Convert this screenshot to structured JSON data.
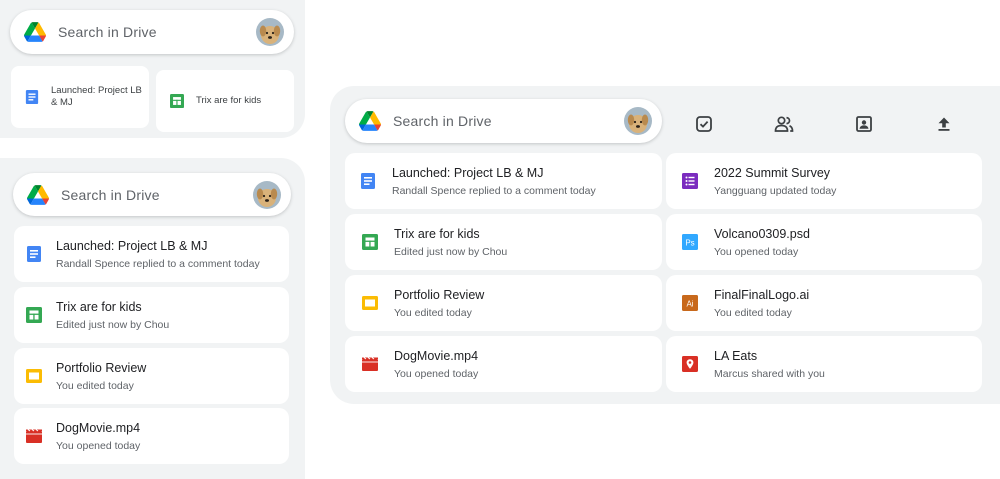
{
  "search": {
    "placeholder": "Search in Drive"
  },
  "small_panel": {
    "files": [
      {
        "title": "Launched: Project LB & MJ",
        "icon": "docs-icon"
      },
      {
        "title": "Trix are for kids",
        "icon": "sheets-icon"
      }
    ]
  },
  "medium_panel": {
    "files": [
      {
        "title": "Launched: Project LB & MJ",
        "subtitle": "Randall Spence replied to a comment today",
        "icon": "docs-icon"
      },
      {
        "title": "Trix are for kids",
        "subtitle": "Edited just now by Chou",
        "icon": "sheets-icon"
      },
      {
        "title": "Portfolio Review",
        "subtitle": "You edited today",
        "icon": "slides-icon"
      },
      {
        "title": "DogMovie.mp4",
        "subtitle": "You opened today",
        "icon": "video-icon"
      }
    ]
  },
  "large_panel": {
    "toolbar": [
      "checkbox-icon",
      "people-icon",
      "drive-photo-icon",
      "upload-icon"
    ],
    "left_files": [
      {
        "title": "Launched: Project LB & MJ",
        "subtitle": "Randall Spence replied to a comment today",
        "icon": "docs-icon"
      },
      {
        "title": "Trix are for kids",
        "subtitle": "Edited just now by Chou",
        "icon": "sheets-icon"
      },
      {
        "title": "Portfolio Review",
        "subtitle": "You edited today",
        "icon": "slides-icon"
      },
      {
        "title": "DogMovie.mp4",
        "subtitle": "You opened today",
        "icon": "video-icon"
      }
    ],
    "right_files": [
      {
        "title": "2022 Summit Survey",
        "subtitle": "Yangguang updated today",
        "icon": "forms-icon"
      },
      {
        "title": "Volcano0309.psd",
        "subtitle": "You opened today",
        "icon": "photoshop-icon"
      },
      {
        "title": "FinalFinalLogo.ai",
        "subtitle": "You edited today",
        "icon": "illustrator-icon"
      },
      {
        "title": "LA Eats",
        "subtitle": "Marcus shared with you",
        "icon": "map-pin-icon"
      }
    ]
  },
  "colors": {
    "docs": "#4285f4",
    "sheets": "#34a853",
    "slides": "#fbbc04",
    "video": "#d93025",
    "forms": "#7b2cbf",
    "photoshop": "#31a8ff",
    "illustrator": "#c8691c",
    "maps": "#d93025",
    "panel_bg": "#f1f3f4"
  }
}
